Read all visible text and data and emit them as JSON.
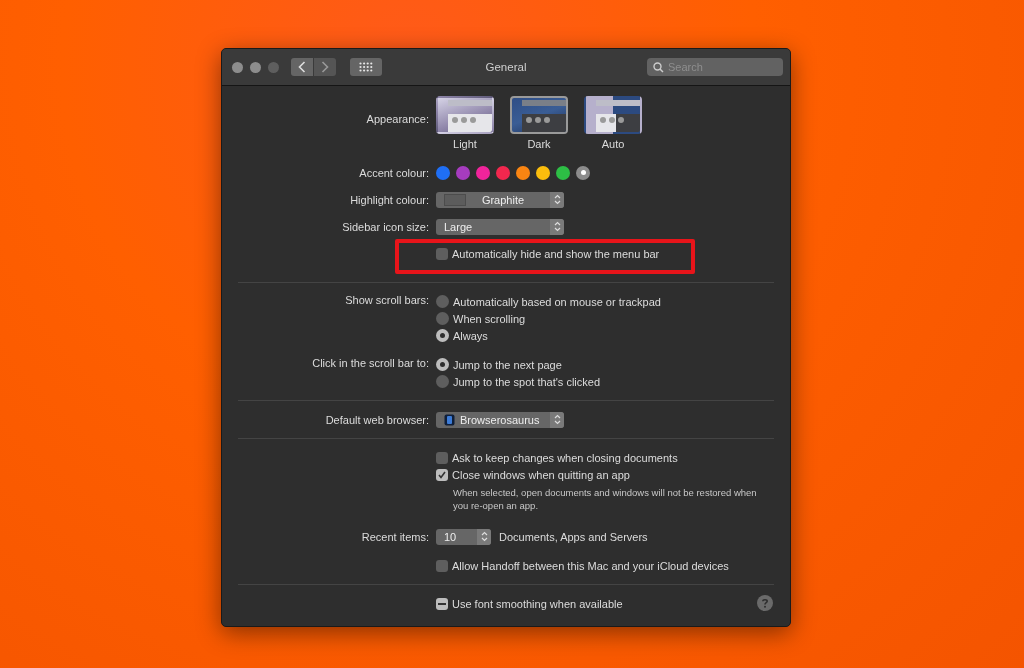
{
  "window": {
    "title": "General"
  },
  "search": {
    "placeholder": "Search"
  },
  "appearance": {
    "label": "Appearance:",
    "options": [
      {
        "label": "Light",
        "kind": "light",
        "selected": false
      },
      {
        "label": "Dark",
        "kind": "dark",
        "selected": true
      },
      {
        "label": "Auto",
        "kind": "auto",
        "selected": false
      }
    ]
  },
  "accent_colour": {
    "label": "Accent colour:",
    "swatches": [
      {
        "color": "#1f6ff5",
        "selected": false
      },
      {
        "color": "#a63cbf",
        "selected": false
      },
      {
        "color": "#f0249b",
        "selected": false
      },
      {
        "color": "#f2274e",
        "selected": false
      },
      {
        "color": "#f98512",
        "selected": false
      },
      {
        "color": "#fbbd0d",
        "selected": false
      },
      {
        "color": "#2dbe45",
        "selected": false
      },
      {
        "color": "#8c8c8c",
        "selected": true
      }
    ]
  },
  "highlight_colour": {
    "label": "Highlight colour:",
    "value": "Graphite"
  },
  "sidebar_icon_size": {
    "label": "Sidebar icon size:",
    "value": "Large"
  },
  "menu_bar": {
    "label": "Automatically hide and show the menu bar",
    "checked": false
  },
  "scroll_bars": {
    "label": "Show scroll bars:",
    "options": [
      {
        "label": "Automatically based on mouse or trackpad",
        "selected": false
      },
      {
        "label": "When scrolling",
        "selected": false
      },
      {
        "label": "Always",
        "selected": true
      }
    ]
  },
  "scroll_click": {
    "label": "Click in the scroll bar to:",
    "options": [
      {
        "label": "Jump to the next page",
        "selected": true
      },
      {
        "label": "Jump to the spot that's clicked",
        "selected": false
      }
    ]
  },
  "default_browser": {
    "label": "Default web browser:",
    "value": "Browserosaurus"
  },
  "document_options": [
    {
      "label": "Ask to keep changes when closing documents",
      "checked": false
    },
    {
      "label": "Close windows when quitting an app",
      "checked": true,
      "note": "When selected, open documents and windows will not be restored when you re-open an app."
    }
  ],
  "recent_items": {
    "label": "Recent items:",
    "value": "10",
    "suffix": "Documents, Apps and Servers"
  },
  "handoff": {
    "label": "Allow Handoff between this Mac and your iCloud devices",
    "checked": false
  },
  "font_smoothing": {
    "label": "Use font smoothing when available",
    "mixed": true
  }
}
